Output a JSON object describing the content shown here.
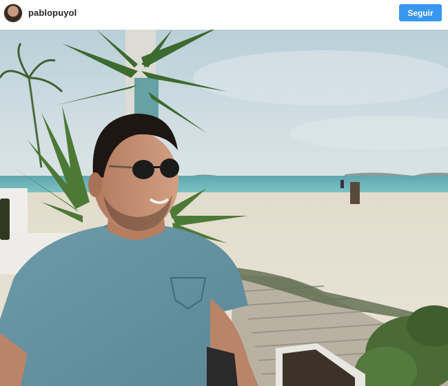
{
  "header": {
    "username": "pablopuyol",
    "follow_label": "Seguir"
  },
  "photo": {
    "alt": "",
    "scene": [
      "sky",
      "sea",
      "sand",
      "palm-trees",
      "pole",
      "man-with-sunglasses",
      "wooden-boardwalk",
      "bush"
    ]
  },
  "colors": {
    "follow_button": "#3897f0",
    "username": "#262626"
  }
}
